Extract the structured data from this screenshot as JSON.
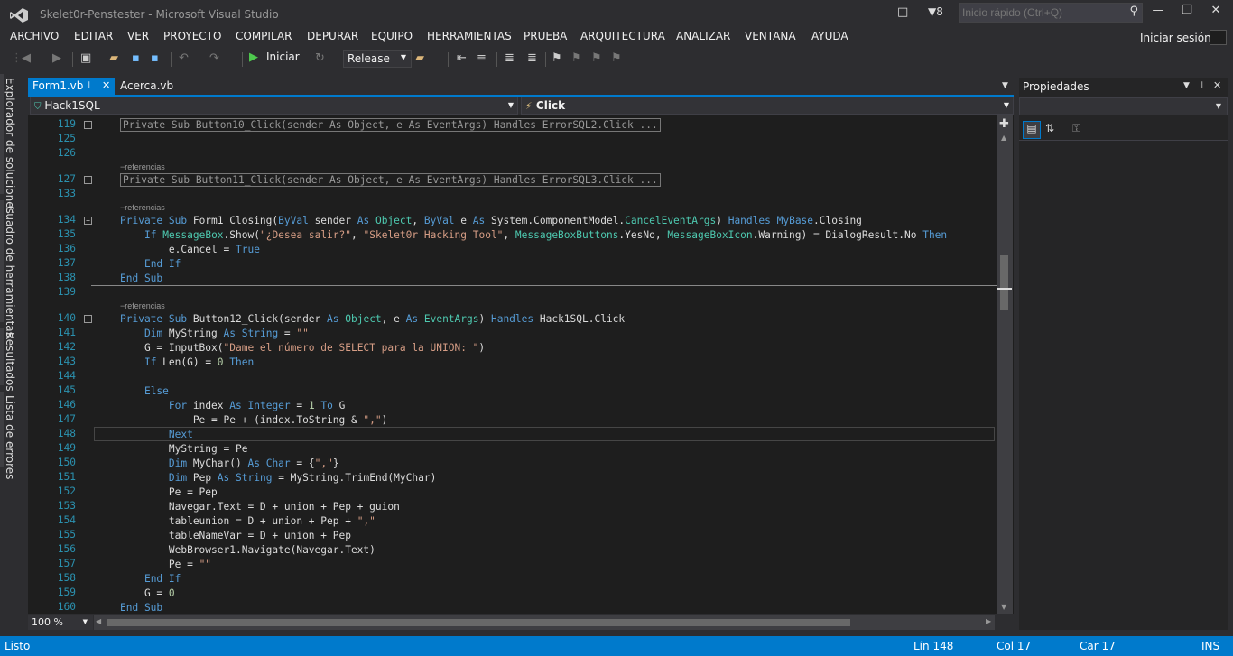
{
  "window": {
    "title": "Skelet0r-Penstester - Microsoft Visual Studio",
    "notifications_count": "8",
    "quick_launch_placeholder": "Inicio rápido (Ctrl+Q)"
  },
  "menu": {
    "items": [
      "ARCHIVO",
      "EDITAR",
      "VER",
      "PROYECTO",
      "COMPILAR",
      "DEPURAR",
      "EQUIPO",
      "HERRAMIENTAS",
      "PRUEBA",
      "ARQUITECTURA",
      "ANALIZAR",
      "VENTANA",
      "AYUDA"
    ],
    "sign_in": "Iniciar sesión"
  },
  "toolbar": {
    "run_label": "Iniciar",
    "configuration": "Release"
  },
  "side_tabs": [
    "Explorador de soluciones",
    "Cuadro de herramientas",
    "Resultados",
    "Lista de errores"
  ],
  "tabs": [
    {
      "label": "Form1.vb",
      "active": true
    },
    {
      "label": "Acerca.vb",
      "active": false
    }
  ],
  "navbar": {
    "left": "Hack1SQL",
    "right": "Click"
  },
  "editor": {
    "zoom": "100 %",
    "ref_label": "−referencias",
    "lines": {
      "l119": "119",
      "c119": "Private Sub Button10_Click(sender As Object, e As EventArgs) Handles ErrorSQL2.Click ...",
      "l125": "125",
      "l126": "126",
      "l127": "127",
      "c127": "Private Sub Button11_Click(sender As Object, e As EventArgs) Handles ErrorSQL3.Click ...",
      "l133": "133",
      "l134": "134",
      "l135": "135",
      "l136": "136",
      "l137": "137",
      "l138": "138",
      "l139": "139",
      "l140": "140",
      "l141": "141",
      "l142": "142",
      "l143": "143",
      "l144": "144",
      "l145": "145",
      "l146": "146",
      "l147": "147",
      "l148": "148",
      "l149": "149",
      "l150": "150",
      "l151": "151",
      "l152": "152",
      "l153": "153",
      "l154": "154",
      "l155": "155",
      "l156": "156",
      "l157": "157",
      "l158": "158",
      "l159": "159",
      "l160": "160"
    }
  },
  "properties": {
    "title": "Propiedades"
  },
  "status": {
    "state": "Listo",
    "line": "Lín 148",
    "col": "Col 17",
    "char": "Car 17",
    "mode": "INS"
  }
}
